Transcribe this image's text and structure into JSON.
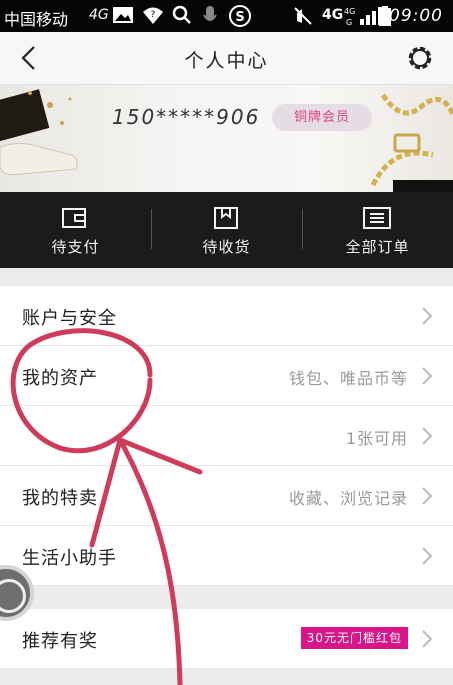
{
  "status_bar": {
    "carrier": "中国移动",
    "network": "4G",
    "net_right": "4G",
    "time": "09:00",
    "icons": [
      "image-icon",
      "wifi-icon",
      "search-icon",
      "mic-icon",
      "s-icon",
      "mute-icon",
      "signal-icon",
      "battery-icon"
    ]
  },
  "header": {
    "title": "个人中心",
    "back_icon": "chevron-left-icon",
    "settings_icon": "gear-icon"
  },
  "profile": {
    "phone": "150*****906",
    "member_level": "铜牌会员"
  },
  "orders": [
    {
      "label": "待支付",
      "icon": "wallet-icon"
    },
    {
      "label": "待收货",
      "icon": "package-icon"
    },
    {
      "label": "全部订单",
      "icon": "list-icon"
    }
  ],
  "menu": [
    {
      "label": "账户与安全",
      "value": ""
    },
    {
      "label": "我的资产",
      "value": "钱包、唯品币等"
    },
    {
      "label": "",
      "value": "1张可用"
    },
    {
      "label": "我的特卖",
      "value": "收藏、浏览记录"
    },
    {
      "label": "生活小助手",
      "value": ""
    }
  ],
  "menu2": [
    {
      "label": "推荐有奖",
      "promo": "30元无门槛红包"
    }
  ],
  "colors": {
    "accent_pink": "#d8168a",
    "badge_text": "#d9467f",
    "annotation": "#cf3b5a"
  }
}
